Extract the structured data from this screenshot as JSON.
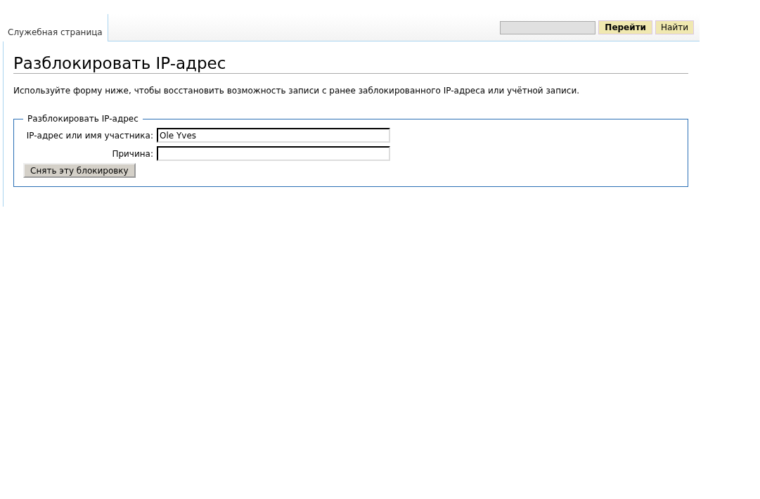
{
  "tab": {
    "label": "Служебная страница",
    "selected": true
  },
  "search": {
    "buttons": [
      "Перейти",
      "Найти"
    ]
  },
  "heading": "Разблокировать IP-адрес",
  "intro": "Используйте форму ниже, чтобы восстановить возможность записи с ранее заблокированного IP-адреса или учётной записи.",
  "form": {
    "legend": "Разблокировать IP-адрес",
    "fields": [
      {
        "label": "IP-адрес или имя участника:",
        "value": "Ole Yves"
      },
      {
        "label": "Причина:"
      }
    ],
    "submit": "Снять эту блокировку"
  }
}
